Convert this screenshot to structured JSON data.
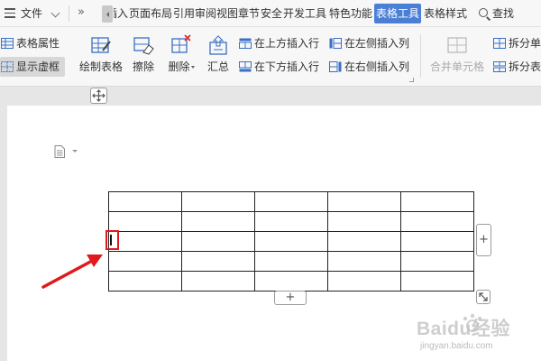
{
  "menu": {
    "file": "文件",
    "expand": "»",
    "tabs": [
      {
        "label": "插入",
        "visible": "插入"
      },
      {
        "label": "页面布局"
      },
      {
        "label": "引用"
      },
      {
        "label": "审阅"
      },
      {
        "label": "视图"
      },
      {
        "label": "章节"
      },
      {
        "label": "安全"
      },
      {
        "label": "开发工具"
      },
      {
        "label": "特色功能"
      },
      {
        "label": "表格工具"
      },
      {
        "label": "表格样式"
      }
    ],
    "search": "查找"
  },
  "ribbon": {
    "table_props": "表格属性",
    "show_grid": "显示虚框",
    "draw_table": "绘制表格",
    "erase": "擦除",
    "delete": "删除",
    "summary": "汇总",
    "insert_above": "在上方插入行",
    "insert_below": "在下方插入行",
    "insert_left": "在左侧插入列",
    "insert_right": "在右侧插入列",
    "merge_cells": "合并单元格",
    "split_cells": "拆分单元格",
    "split_table": "拆分表格"
  },
  "table": {
    "rows": 5,
    "cols": 5
  },
  "controls": {
    "add_col": "+",
    "add_row": "+"
  },
  "watermark": {
    "text": "Baidu经验",
    "url": "jingyan.baidu.com"
  },
  "colors": {
    "accent": "#4b7fd6",
    "arrow": "#e0191d"
  }
}
